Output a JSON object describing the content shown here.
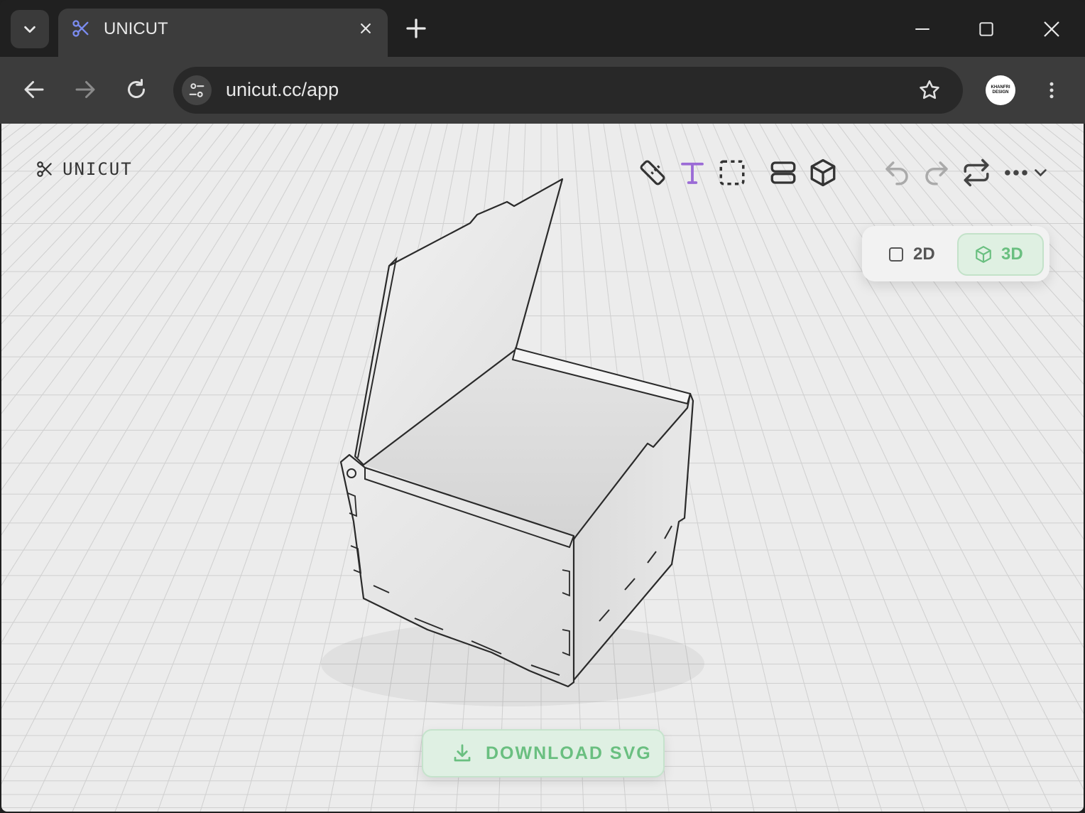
{
  "browser": {
    "tab_title": "UNICUT",
    "url": "unicut.cc/app",
    "profile_text_line1": "KHANFRI",
    "profile_text_line2": "DESIGN"
  },
  "app": {
    "logo_text": "UNICUT",
    "tools": [
      "ruler-icon",
      "text-icon",
      "select-icon",
      "layers-icon",
      "cube-icon"
    ],
    "history": [
      "undo-icon",
      "redo-icon",
      "repeat-icon",
      "more-icon"
    ],
    "view_toggle": {
      "option_2d": "2D",
      "option_3d": "3D",
      "selected": "3D"
    },
    "download_label": "DOWNLOAD SVG"
  },
  "colors": {
    "accent_green": "#6abf80",
    "accent_purple": "#9b6bd6",
    "tab_icon_blue": "#7b8cf0"
  }
}
